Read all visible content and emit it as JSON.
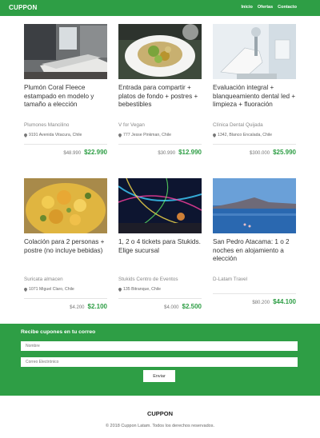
{
  "header": {
    "logo": "CUPPON",
    "nav": [
      "Inicio",
      "Ofertas",
      "Contacto"
    ]
  },
  "deals": [
    {
      "image": "bedroom-photo",
      "title": "Plumón Coral Fleece estampado en modelo y tamaño a elección",
      "merchant": "Plumones Mancilino",
      "location": "9191 Avenida Vitacura, Chile",
      "old_price": "$48.990",
      "new_price": "$22.990"
    },
    {
      "image": "salad-photo",
      "title": "Entrada para compartir + platos de fondo + postres + bebestibles",
      "merchant": "V for Vegan",
      "location": "777 Jesse Pinkman, Chile",
      "old_price": "$30.990",
      "new_price": "$12.990"
    },
    {
      "image": "dental-chair-photo",
      "title": "Evaluación integral + blanqueamiento dental led + limpieza + fluoración",
      "merchant": "Clínica Dental Quijada",
      "location": "1342, Blanco Encalada, Chile",
      "old_price": "$300.000",
      "new_price": "$25.990"
    },
    {
      "image": "pasta-photo",
      "title": "Colación para 2 personas + postre (no incluye bebidas)",
      "merchant": "Suricata almacen",
      "location": "1071 Miguel Claro, Chile",
      "old_price": "$4.200",
      "new_price": "$2.100"
    },
    {
      "image": "amusement-park-photo",
      "title": "1, 2 o 4 tickets para Stukids. Elige sucursal",
      "merchant": "Stukids Centro de Eventos",
      "location": "135 Bitranque, Chile",
      "old_price": "$4.000",
      "new_price": "$2.500"
    },
    {
      "image": "lake-landscape-photo",
      "title": "San Pedro Atacama: 1 o 2 noches en alojamiento a elección",
      "merchant": "D-Latam Travel",
      "location": "",
      "old_price": "$80.200",
      "new_price": "$44.100"
    }
  ],
  "newsletter": {
    "title": "Recibe cupones en tu correo",
    "name_placeholder": "Nombre",
    "email_placeholder": "Correo Electrónico",
    "button": "Enviar"
  },
  "footer": {
    "logo": "CUPPON",
    "copyright": "© 2018 Cuppon Latam. Todos los derechos reservados."
  },
  "colors": {
    "brand": "#2e9e45",
    "price": "#2e9e45"
  }
}
